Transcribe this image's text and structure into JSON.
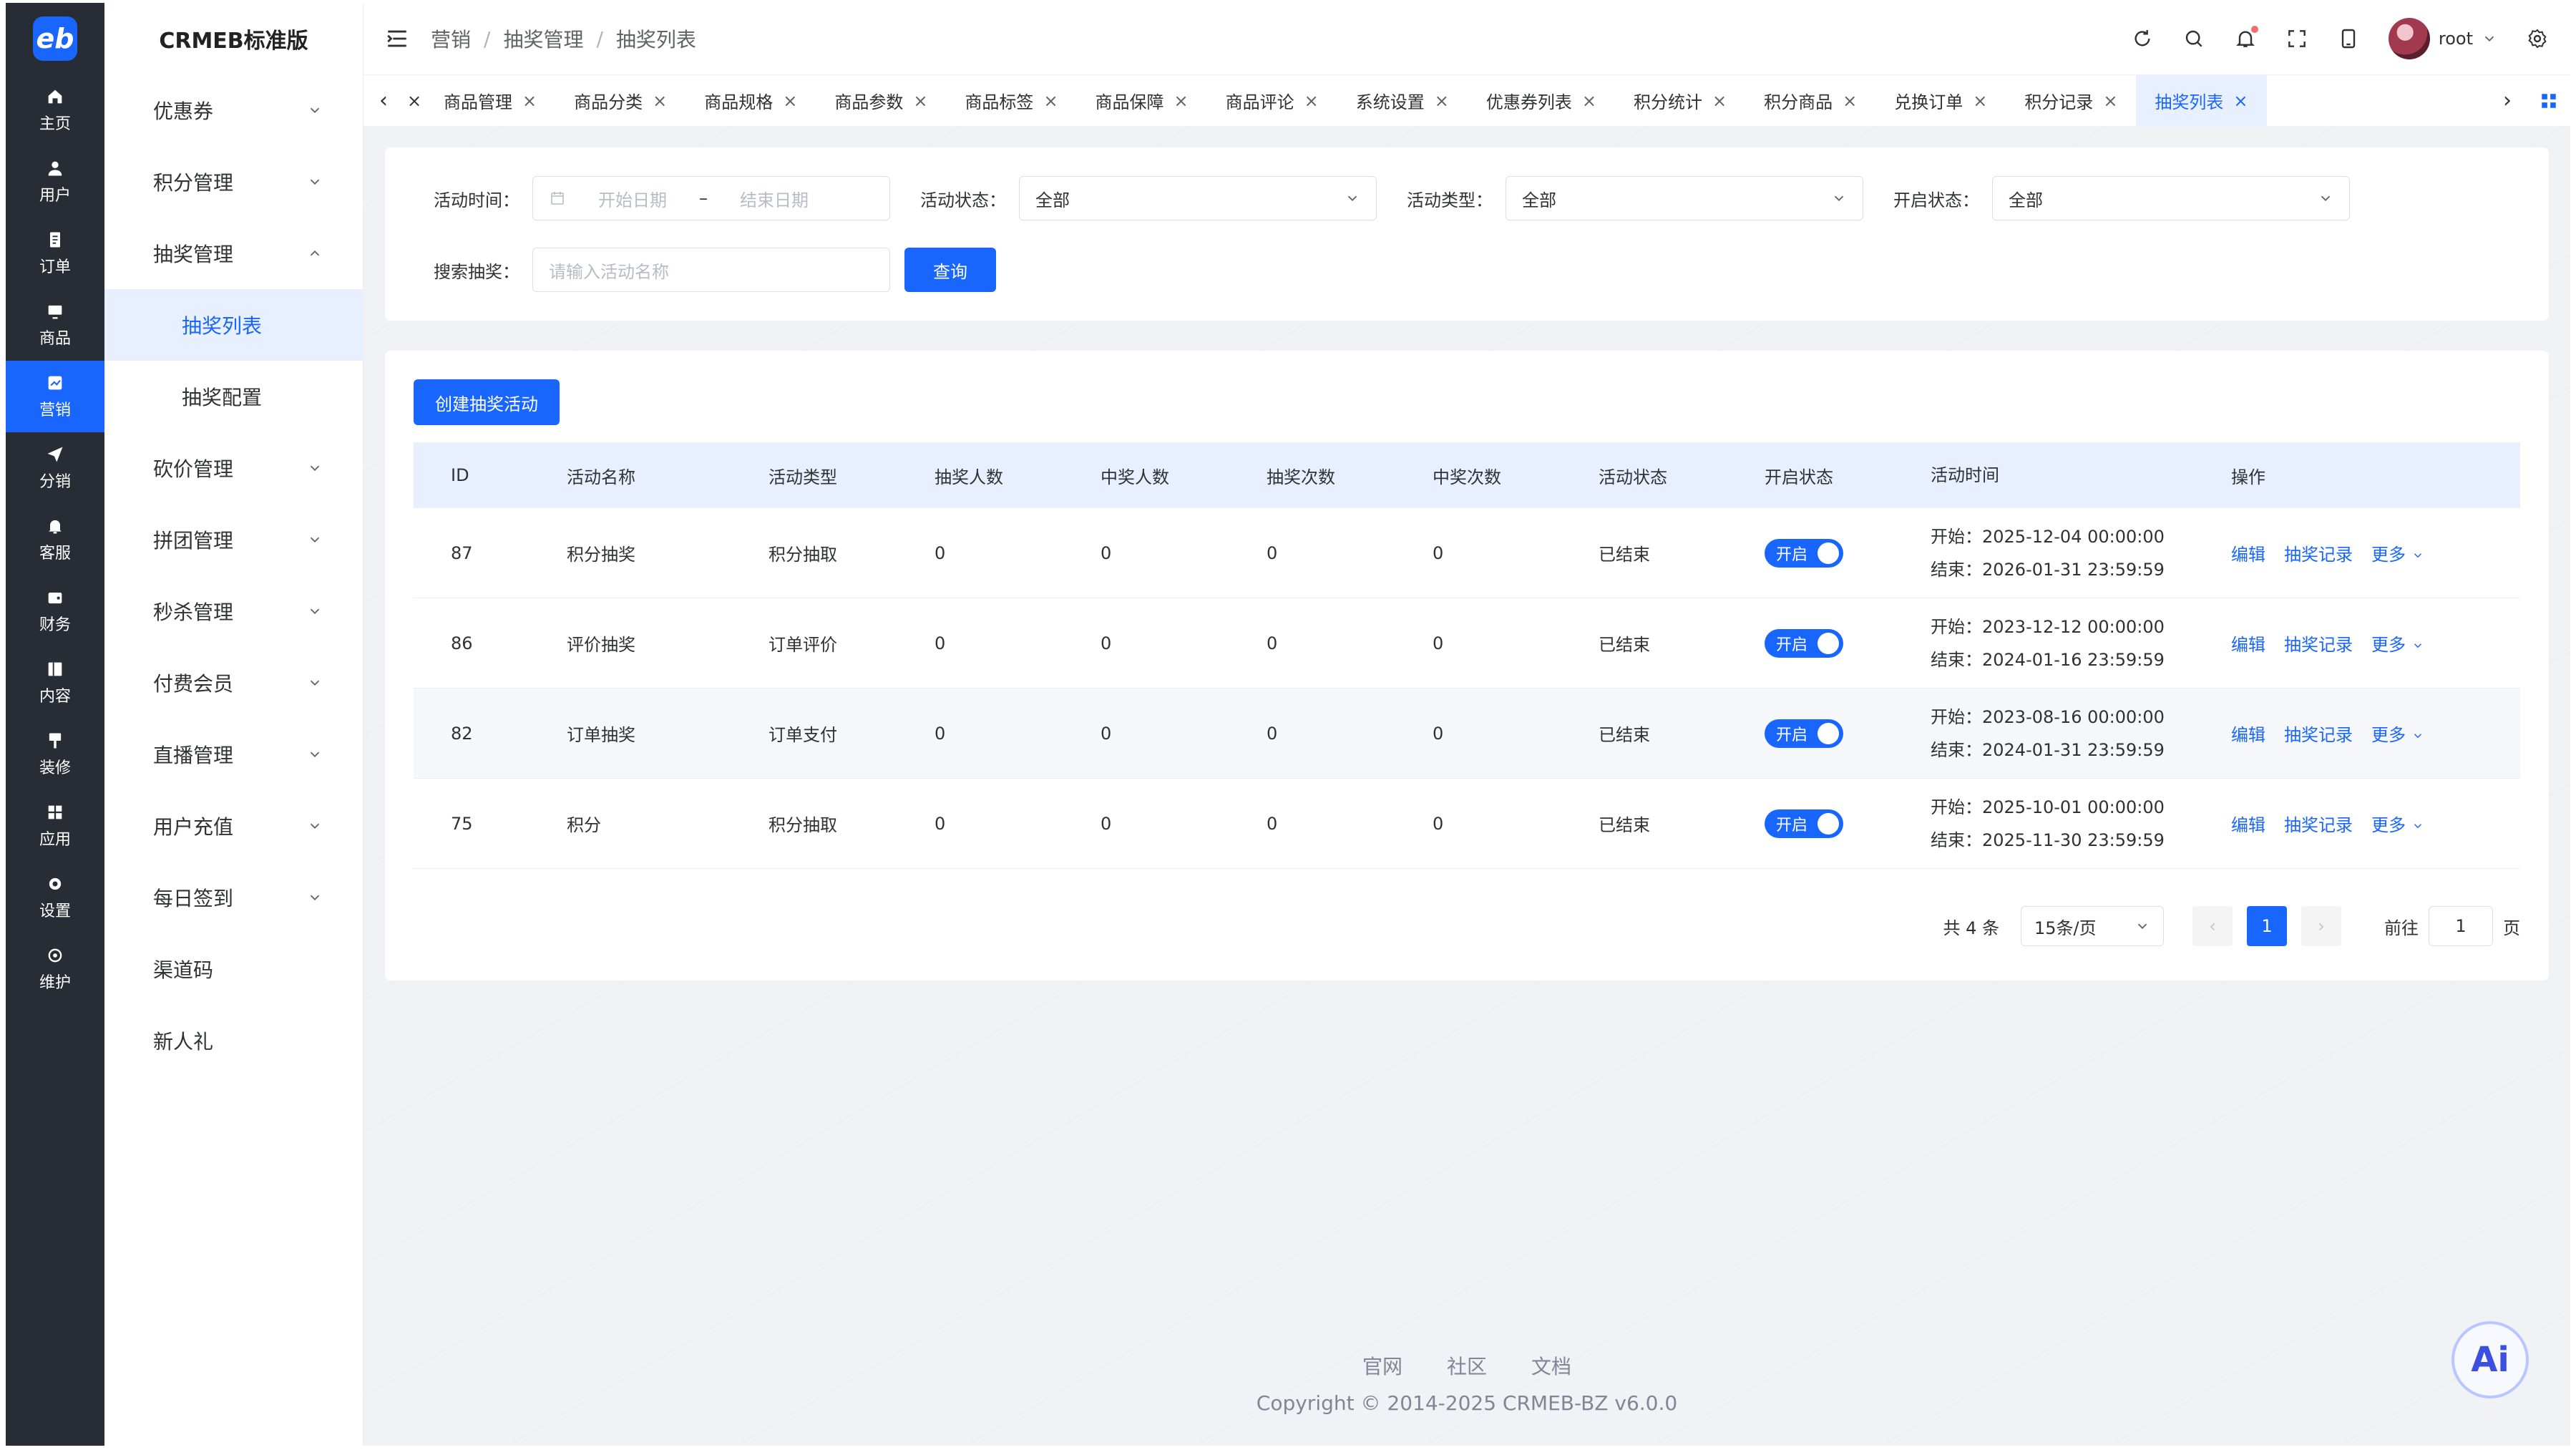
{
  "brand": {
    "logo_text": "eb",
    "app_title": "CRMEB标准版"
  },
  "rail": [
    {
      "key": "home",
      "label": "主页",
      "icon": "home-icon"
    },
    {
      "key": "user",
      "label": "用户",
      "icon": "user-icon"
    },
    {
      "key": "order",
      "label": "订单",
      "icon": "order-icon"
    },
    {
      "key": "product",
      "label": "商品",
      "icon": "product-icon"
    },
    {
      "key": "marketing",
      "label": "营销",
      "icon": "marketing-icon",
      "active": true
    },
    {
      "key": "distribution",
      "label": "分销",
      "icon": "send-icon"
    },
    {
      "key": "service",
      "label": "客服",
      "icon": "bell-icon"
    },
    {
      "key": "finance",
      "label": "财务",
      "icon": "finance-icon"
    },
    {
      "key": "content",
      "label": "内容",
      "icon": "content-icon"
    },
    {
      "key": "decoration",
      "label": "装修",
      "icon": "decoration-icon"
    },
    {
      "key": "apps",
      "label": "应用",
      "icon": "apps-icon"
    },
    {
      "key": "settings",
      "label": "设置",
      "icon": "gear-icon"
    },
    {
      "key": "maintain",
      "label": "维护",
      "icon": "maintain-icon"
    }
  ],
  "submenu": {
    "items": [
      {
        "label": "优惠券",
        "expandable": true
      },
      {
        "label": "积分管理",
        "expandable": true
      },
      {
        "label": "抽奖管理",
        "expandable": true,
        "open": true
      },
      {
        "label": "抽奖列表",
        "sub": true,
        "active": true
      },
      {
        "label": "抽奖配置",
        "sub": true
      },
      {
        "label": "砍价管理",
        "expandable": true
      },
      {
        "label": "拼团管理",
        "expandable": true
      },
      {
        "label": "秒杀管理",
        "expandable": true
      },
      {
        "label": "付费会员",
        "expandable": true
      },
      {
        "label": "直播管理",
        "expandable": true
      },
      {
        "label": "用户充值",
        "expandable": true
      },
      {
        "label": "每日签到",
        "expandable": true
      },
      {
        "label": "渠道码"
      },
      {
        "label": "新人礼"
      }
    ]
  },
  "header": {
    "breadcrumb": [
      "营销",
      "抽奖管理",
      "抽奖列表"
    ],
    "username": "root"
  },
  "tabs": [
    {
      "label": "商品管理"
    },
    {
      "label": "商品分类"
    },
    {
      "label": "商品规格"
    },
    {
      "label": "商品参数"
    },
    {
      "label": "商品标签"
    },
    {
      "label": "商品保障"
    },
    {
      "label": "商品评论"
    },
    {
      "label": "系统设置"
    },
    {
      "label": "优惠券列表"
    },
    {
      "label": "积分统计"
    },
    {
      "label": "积分商品"
    },
    {
      "label": "兑换订单"
    },
    {
      "label": "积分记录"
    },
    {
      "label": "抽奖列表",
      "active": true
    }
  ],
  "filters": {
    "time_label": "活动时间：",
    "start_placeholder": "开始日期",
    "range_sep": "–",
    "end_placeholder": "结束日期",
    "status_label": "活动状态：",
    "status_value": "全部",
    "type_label": "活动类型：",
    "type_value": "全部",
    "open_label": "开启状态：",
    "open_value": "全部",
    "search_label": "搜索抽奖：",
    "search_placeholder": "请输入活动名称",
    "query_button": "查询"
  },
  "table": {
    "create_button": "创建抽奖活动",
    "columns": [
      "ID",
      "活动名称",
      "活动类型",
      "抽奖人数",
      "中奖人数",
      "抽奖次数",
      "中奖次数",
      "活动状态",
      "开启状态",
      "活动时间",
      "操作"
    ],
    "switch_on_label": "开启",
    "actions": {
      "edit": "编辑",
      "records": "抽奖记录",
      "more": "更多"
    },
    "rows": [
      {
        "id": "87",
        "name": "积分抽奖",
        "type": "积分抽取",
        "draw_users": "0",
        "win_users": "0",
        "draw_times": "0",
        "win_times": "0",
        "status": "已结束",
        "start": "开始：2025-12-04 00:00:00",
        "end": "结束：2026-01-31 23:59:59"
      },
      {
        "id": "86",
        "name": "评价抽奖",
        "type": "订单评价",
        "draw_users": "0",
        "win_users": "0",
        "draw_times": "0",
        "win_times": "0",
        "status": "已结束",
        "start": "开始：2023-12-12 00:00:00",
        "end": "结束：2024-01-16 23:59:59"
      },
      {
        "id": "82",
        "name": "订单抽奖",
        "type": "订单支付",
        "draw_users": "0",
        "win_users": "0",
        "draw_times": "0",
        "win_times": "0",
        "status": "已结束",
        "start": "开始：2023-08-16 00:00:00",
        "end": "结束：2024-01-31 23:59:59"
      },
      {
        "id": "75",
        "name": "积分",
        "type": "积分抽取",
        "draw_users": "0",
        "win_users": "0",
        "draw_times": "0",
        "win_times": "0",
        "status": "已结束",
        "start": "开始：2025-10-01 00:00:00",
        "end": "结束：2025-11-30 23:59:59"
      }
    ]
  },
  "pagination": {
    "total": "共 4 条",
    "page_size": "15条/页",
    "current": "1",
    "goto_label": "前往",
    "goto_value": "1",
    "page_unit": "页"
  },
  "footer": {
    "links": [
      "官网",
      "社区",
      "文档"
    ],
    "copyright": "Copyright © 2014-2025 CRMEB-BZ v6.0.0"
  },
  "ai_badge": "Ai",
  "colors": {
    "primary": "#1966ff",
    "rail_bg": "#282c34",
    "page_bg": "#f0f2f5",
    "header_row_bg": "#e8f0ff"
  }
}
